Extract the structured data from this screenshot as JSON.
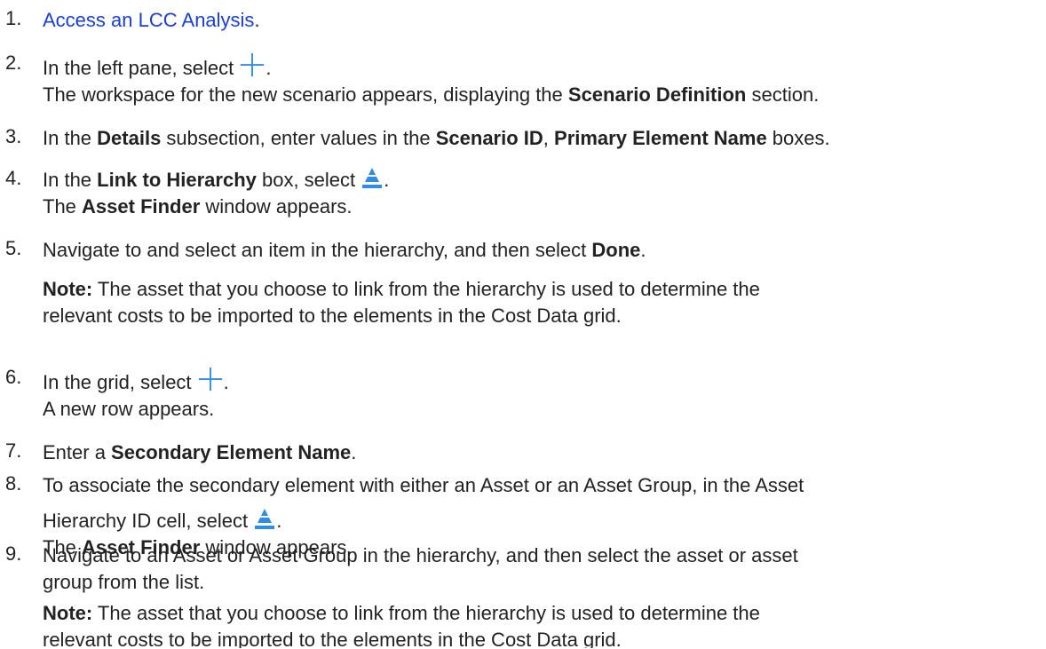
{
  "steps": [
    {
      "number": "1.",
      "link_text": "Access an LCC Analysis",
      "after": "."
    },
    {
      "number": "2.",
      "before": "In the left pane, select ",
      "icon": "plus-icon",
      "after": ".",
      "result": {
        "before": "The workspace for the new scenario appears, displaying the ",
        "bold": "Scenario Definition",
        "after": " section."
      }
    },
    {
      "number": "3.",
      "t1": "In the ",
      "b1": "Details",
      "t2": " subsection, enter values in the ",
      "b2": "Scenario ID",
      "t3": ", ",
      "b3": "Primary Element Name",
      "t4": " boxes."
    },
    {
      "number": "4.",
      "t1": "In the ",
      "b1": "Link to Hierarchy",
      "t2": " box, select ",
      "icon": "hierarchy-icon",
      "after": ".",
      "result": {
        "before": "The ",
        "bold": "Asset Finder",
        "after": " window appears."
      }
    },
    {
      "number": "5.",
      "t1": "Navigate to and select an item in the hierarchy, and then select ",
      "b1": "Done",
      "after": ".",
      "note": {
        "label": "Note:",
        "line1": " The asset that you choose to link from the hierarchy is used to determine the",
        "line2": "relevant costs to be imported to the elements in the Cost Data grid."
      }
    },
    {
      "number": "6.",
      "before": "In the grid, select ",
      "icon": "plus-icon",
      "after": ".",
      "result": "A new row appears."
    },
    {
      "number": "7.",
      "t1": "Enter a ",
      "b1": "Secondary Element Name",
      "after": "."
    },
    {
      "number": "8.",
      "line1": "To associate the secondary element with either an Asset or an Asset Group, in the Asset",
      "line2_before": "Hierarchy ID cell, select ",
      "icon": "hierarchy-icon",
      "line2_after": ".",
      "result": {
        "before": "The ",
        "bold": "Asset Finder",
        "after": " window appears."
      }
    },
    {
      "number": "9.",
      "line1": "Navigate to an Asset or Asset Group in the hierarchy, and then select the asset or asset",
      "line2": "group from the list.",
      "note": {
        "label": "Note:",
        "line1": " The asset that you choose to link from the hierarchy is used to determine the",
        "line2": "relevant costs to be imported to the elements in the Cost Data grid."
      }
    }
  ],
  "colors": {
    "text": "#222222",
    "link": "#1a3fd6",
    "icon_blue": "#2e8be6"
  }
}
